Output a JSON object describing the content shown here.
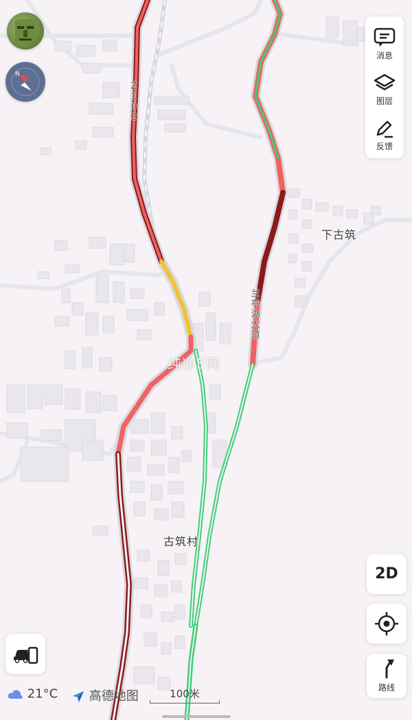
{
  "map": {
    "places": [
      {
        "name": "下古筑"
      },
      {
        "name": "古筑村"
      }
    ],
    "roads": [
      {
        "name": "Z102"
      },
      {
        "name": "兰亭湖大道"
      }
    ],
    "watermark": "纯净E网",
    "traffic_colors": {
      "congested": "#8b1a1a",
      "slow": "#f06262",
      "moderate": "#f2c230",
      "clear": "#3ecf78"
    }
  },
  "panel": {
    "messages": "消息",
    "layers": "图层",
    "feedback": "反馈"
  },
  "controls": {
    "mode_2d": "2D",
    "route": "路线"
  },
  "bottom": {
    "temperature": "21°C",
    "brand": "高德地图",
    "scale": "100米"
  }
}
